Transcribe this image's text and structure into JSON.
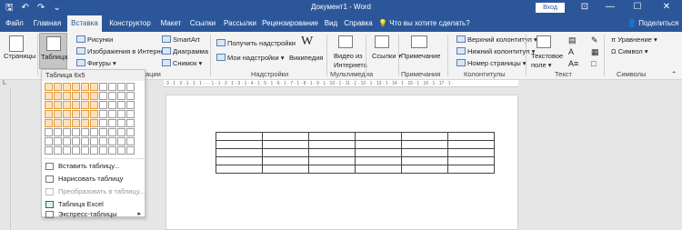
{
  "titlebar": {
    "doc_title": "Документ1 - Word",
    "signin_label": "Вход",
    "save_icon": "save-icon",
    "undo_icon": "undo-icon",
    "redo_icon": "redo-icon",
    "minimize": "—",
    "maximize": "☐",
    "close": "✕",
    "ribbon_display": "⊡"
  },
  "tabs": [
    {
      "label": "Файл"
    },
    {
      "label": "Главная"
    },
    {
      "label": "Вставка"
    },
    {
      "label": "Конструктор"
    },
    {
      "label": "Макет"
    },
    {
      "label": "Ссылки"
    },
    {
      "label": "Рассылки"
    },
    {
      "label": "Рецензирование"
    },
    {
      "label": "Вид"
    },
    {
      "label": "Справка"
    }
  ],
  "search_label": "Что вы хотите сделать?",
  "share_label": "Поделиться",
  "ribbon": {
    "pages": "Страницы",
    "table": "Таблица",
    "pictures": "Рисунки",
    "online_images": "Изображения в Интернете",
    "shapes": "Фигуры",
    "smartart": "SmartArt",
    "chart": "Диаграмма",
    "screenshot": "Снимок",
    "get_addins": "Получить надстройки",
    "my_addins": "Мои надстройки",
    "wikipedia": "Википедия",
    "online_video_1": "Видео из",
    "online_video_2": "Интернета",
    "links": "Ссылки",
    "comment": "Примечание",
    "header": "Верхний колонтитул",
    "footer": "Нижний колонтитул",
    "page_number": "Номер страницы",
    "textbox_1": "Текстовое",
    "textbox_2": "поле",
    "equation": "Уравнение",
    "symbol": "Символ",
    "groups": {
      "illustrations_tail": "ации",
      "addins": "Надстройки",
      "media": "Мультимедиа",
      "comments": "Примечания",
      "header_footer": "Колонтитулы",
      "text": "Текст",
      "symbols": "Символы"
    }
  },
  "ruler_text": "· 3 · 1 · 2 · 1 · 1 · 1 · · · 1 · 1 · 2 · 1 · 3 · 1 · 4 · 1 · 5 · 1 · 6 · 1 · 7 · 1 · 8 · 1 · 9 · 1 · 10 · 1 · 11 · 1 · 12 · 1 · 13 · 1 · 14 · 1 · 15 · 1 · 16 · 1 · 17 · 1 ·",
  "dropdown": {
    "header": "Таблица 6x5",
    "grid_cols": 10,
    "grid_rows": 8,
    "selected_cols": 6,
    "selected_rows": 5,
    "items": [
      {
        "label": "Вставить таблицу...",
        "disabled": false
      },
      {
        "label": "Нарисовать таблицу",
        "disabled": false
      },
      {
        "label": "Преобразовать в таблицу...",
        "disabled": true
      },
      {
        "label": "Таблица Excel",
        "disabled": false
      },
      {
        "label": "Экспресс-таблицы",
        "disabled": false,
        "submenu": "▸"
      }
    ]
  },
  "document_table": {
    "rows": 5,
    "cols": 6
  },
  "colors": {
    "accent": "#2b579a",
    "selection": "#fbe1c0"
  }
}
